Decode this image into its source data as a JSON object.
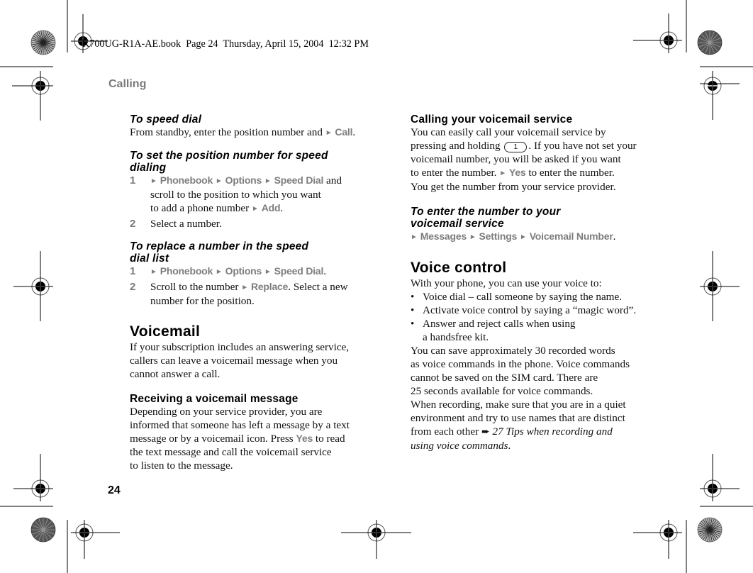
{
  "print_header": {
    "book_info": "K700UG-R1A-AE.book  Page 24  Thursday, April 15, 2004  12:32 PM"
  },
  "running_head": "Calling",
  "page_number": "24",
  "left_column": {
    "speed_dial": {
      "heading": "To speed dial",
      "text_before": "From standby, enter the position number and ",
      "menu": "Call",
      "text_after": "."
    },
    "set_position": {
      "heading_line1": "To set the position number for speed",
      "heading_line2": "dialing",
      "steps": [
        {
          "num": "1",
          "menu1": "Phonebook",
          "menu2": "Options",
          "menu3": "Speed Dial",
          "text1": " and",
          "text2": "scroll to the position to which you want",
          "text3": "to add a phone number ",
          "menu4": "Add",
          "text4": "."
        },
        {
          "num": "2",
          "text": "Select a number."
        }
      ]
    },
    "replace_number": {
      "heading_line1": "To replace a number in the speed",
      "heading_line2": "dial list",
      "steps": [
        {
          "num": "1",
          "menu1": "Phonebook",
          "menu2": "Options",
          "menu3": "Speed Dial",
          "text_after": "."
        },
        {
          "num": "2",
          "text1": "Scroll to the number ",
          "menu": "Replace",
          "text2": ". Select a new",
          "text3": "number for the position."
        }
      ]
    },
    "voicemail": {
      "heading": "Voicemail",
      "lines": [
        "If your subscription includes an answering service,",
        "callers can leave a voicemail message when you",
        "cannot answer a call."
      ]
    },
    "receiving": {
      "heading": "Receiving a voicemail message",
      "line1": "Depending on your service provider, you are",
      "line2": "informed that someone has left a message by a text",
      "line3_before": "message or by a voicemail icon. Press ",
      "line3_menu": "Yes",
      "line3_after": " to read",
      "line4": "the text message and call the voicemail service",
      "line5": "to listen to the message."
    }
  },
  "right_column": {
    "calling_service": {
      "heading": "Calling your voicemail service",
      "line1": "You can easily call your voicemail service by",
      "line2_before": "pressing and holding ",
      "key": "1",
      "line2_after": ". If you have not set your",
      "line3": "voicemail number, you will be asked if you want",
      "line4_before": "to enter the number. ",
      "line4_menu": "Yes",
      "line4_after": " to enter the number.",
      "line5": "You get the number from your service provider."
    },
    "enter_number": {
      "heading_line1": "To enter the number to your",
      "heading_line2": "voicemail service",
      "menu1": "Messages",
      "menu2": "Settings",
      "menu3": "Voicemail Number",
      "text_after": "."
    },
    "voice_control": {
      "heading": "Voice control",
      "intro": "With your phone, you can use your voice to:",
      "bullets": [
        {
          "line1": "Voice dial – call someone by saying the name."
        },
        {
          "line1": "Activate voice control by saying a “magic word”."
        },
        {
          "line1": "Answer and reject calls when using",
          "line2": "a handsfree kit."
        }
      ],
      "para1": [
        "You can save approximately 30 recorded words",
        "as voice commands in the phone. Voice commands",
        "cannot be saved on the SIM card. There are",
        "25 seconds available for voice commands."
      ],
      "para2_line1": "When recording, make sure that you are in a quiet",
      "para2_line2": "environment and try to use names that are distinct",
      "para2_line3_before": "from each other ",
      "xref": "27 Tips when recording and",
      "xref_line2": "using voice commands",
      "para2_end": "."
    }
  },
  "glyphs": {
    "menu_arrow": "►",
    "bullet": "•",
    "xref_arrow": "➨"
  },
  "colors": {
    "menu_gray": "#7d7d7d",
    "heading_gray": "#7a7a7a"
  }
}
